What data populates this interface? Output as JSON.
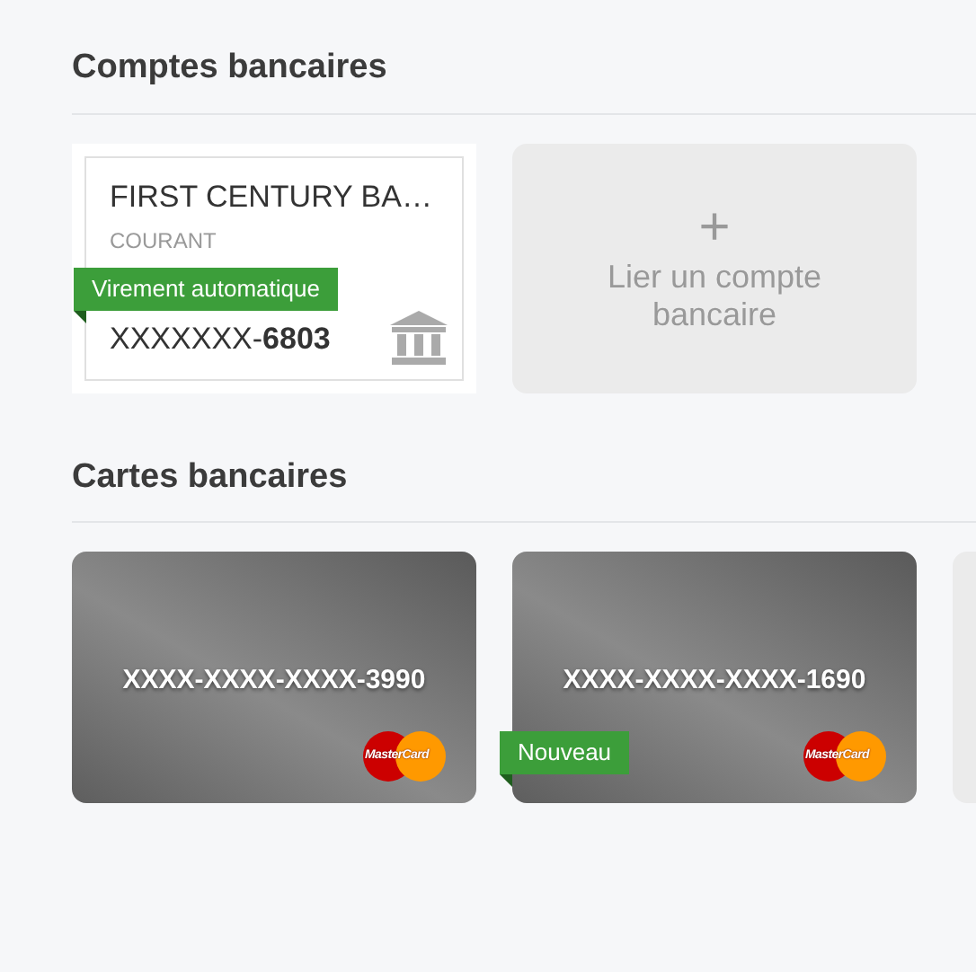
{
  "accounts_section": {
    "title": "Comptes bancaires",
    "accounts": [
      {
        "bank": "FIRST CENTURY BA…",
        "type": "COURANT",
        "badge": "Virement automatique",
        "number": "XXXXXXX-**6803**"
      }
    ],
    "link_card": {
      "icon": "+",
      "label": "Lier un compte bancaire"
    }
  },
  "cards_section": {
    "title": "Cartes bancaires",
    "cards": [
      {
        "kind": "card",
        "number": "XXXX-XXXX-XXXX-3990",
        "brand": "MasterCard"
      },
      {
        "kind": "card",
        "number": "XXXX-XXXX-XXXX-1690",
        "brand": "MasterCard",
        "badge": "Nouveau"
      },
      {
        "kind": "placeholder"
      }
    ]
  }
}
